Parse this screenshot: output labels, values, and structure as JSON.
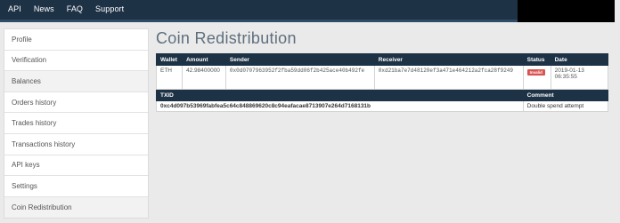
{
  "nav": {
    "items": [
      "API",
      "News",
      "FAQ",
      "Support"
    ]
  },
  "sidebar": {
    "items": [
      {
        "label": "Profile"
      },
      {
        "label": "Verification"
      },
      {
        "label": "Balances"
      },
      {
        "label": "Orders history"
      },
      {
        "label": "Trades history"
      },
      {
        "label": "Transactions history"
      },
      {
        "label": "API keys"
      },
      {
        "label": "Settings"
      },
      {
        "label": "Coin Redistribution"
      }
    ]
  },
  "main": {
    "title": "Coin Redistribution",
    "table": {
      "headers": [
        "Wallet",
        "Amount",
        "Sender",
        "Receiver",
        "Status",
        "Date"
      ],
      "row": {
        "wallet": "ETH",
        "amount": "42.98400000",
        "sender": "0x0d0707963952f2fba59dd06f2b425ace40b492fe",
        "receiver": "0xd21ba7e7d48120ef3a471e464212a2fca28f9249",
        "status": "Invalid",
        "date_line1": "2019-01-13",
        "date_line2": "06:35:55"
      },
      "sub_headers": {
        "txid": "TXID",
        "comment": "Comment"
      },
      "txid_row": {
        "txid": "0xc4d097b53969fabfea5c64c848869620c8c94eafacae8713907e264d7168131b",
        "comment": "Double spend attempt"
      }
    }
  },
  "colors": {
    "navbar": "#1e3246",
    "status_invalid": "#d9534f"
  }
}
